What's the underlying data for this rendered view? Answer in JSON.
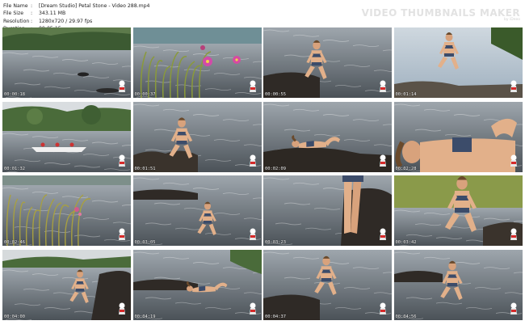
{
  "header": {
    "rows": [
      {
        "label": "File Name",
        "value": "[Dream Studio] Petal Stone - Video 288.mp4"
      },
      {
        "label": "File Size",
        "value": "343.11 MB"
      },
      {
        "label": "Resolution",
        "value": "1280x720 / 29.97 fps"
      },
      {
        "label": "Duration",
        "value": "00:05:15"
      }
    ],
    "separator": ":",
    "brand_title": "VIDEO THUMBNAILS MAKER",
    "brand_sub": "by iDeeo"
  },
  "thumbs": [
    {
      "time": "00:00:18",
      "scene": "river"
    },
    {
      "time": "00:00:37",
      "scene": "flowers"
    },
    {
      "time": "00:00:55",
      "scene": "water-sit"
    },
    {
      "time": "00:01:14",
      "scene": "bright-water"
    },
    {
      "time": "00:01:32",
      "scene": "boats"
    },
    {
      "time": "00:01:51",
      "scene": "rock-sit"
    },
    {
      "time": "00:02:09",
      "scene": "lying"
    },
    {
      "time": "00:02:28",
      "scene": "closeup"
    },
    {
      "time": "00:02:46",
      "scene": "grass-sunset"
    },
    {
      "time": "00:03:05",
      "scene": "swim"
    },
    {
      "time": "00:03:23",
      "scene": "legs"
    },
    {
      "time": "00:03:42",
      "scene": "standing"
    },
    {
      "time": "00:04:00",
      "scene": "shore"
    },
    {
      "time": "00:04:19",
      "scene": "splash"
    },
    {
      "time": "00:04:37",
      "scene": "water-sit2"
    },
    {
      "time": "00:04:56",
      "scene": "rock-water"
    }
  ]
}
